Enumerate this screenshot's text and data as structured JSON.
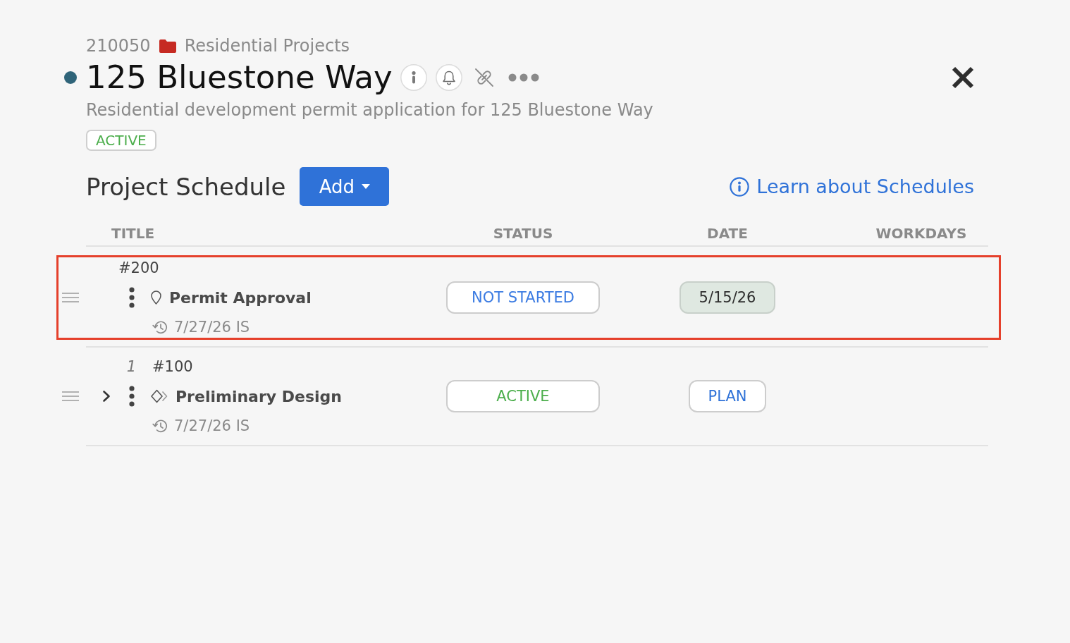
{
  "project": {
    "number": "210050",
    "folder": "Residential Projects",
    "status_dot": {
      "color": "#2f6479"
    },
    "title": "125 Bluestone Way",
    "description": "Residential development permit application for 125 Bluestone Way",
    "status": {
      "label": "ACTIVE",
      "kind": "active"
    }
  },
  "schedule": {
    "heading": "Project Schedule",
    "add_button": "Add",
    "help_link": "Learn about Schedules",
    "columns": [
      "TITLE",
      "STATUS",
      "DATE",
      "WORKDAYS"
    ],
    "rows": [
      {
        "selected": true,
        "kind": "milestone",
        "number": "#200",
        "title": "Permit Approval",
        "updated": "7/27/26 IS",
        "status": {
          "label": "NOT STARTED",
          "kind": "not_started"
        },
        "date": {
          "label": "5/15/26",
          "kind": "date"
        }
      },
      {
        "selected": false,
        "kind": "phase",
        "index": "1",
        "toggle": {
          "expanded": false
        },
        "number": "#100",
        "title": "Preliminary Design",
        "updated": "7/27/26 IS",
        "status": {
          "label": "ACTIVE",
          "kind": "active"
        },
        "date": {
          "label": "PLAN",
          "kind": "plan"
        }
      }
    ]
  }
}
